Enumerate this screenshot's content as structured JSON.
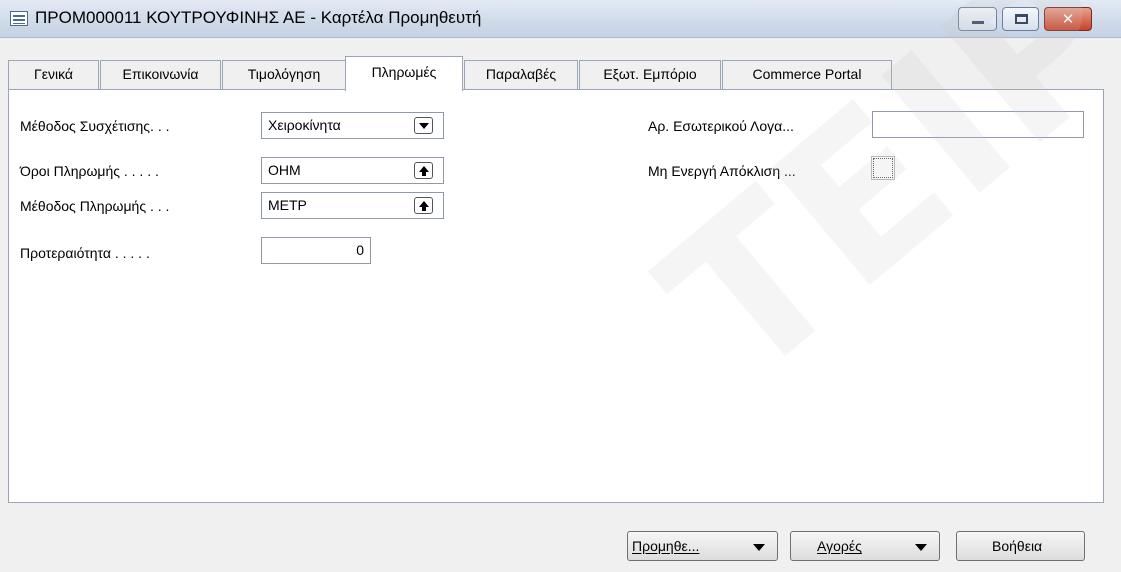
{
  "window": {
    "title": "ΠΡΟΜ000011 ΚΟΥΤΡΟΥΦΙΝΗΣ ΑΕ - Καρτέλα Προμηθευτή",
    "icon": "form-icon",
    "controls": {
      "minimize": "minimize-icon",
      "maximize": "maximize-icon",
      "close": "✕"
    }
  },
  "tabs": [
    {
      "label": "Γενικά"
    },
    {
      "label": "Επικοινωνία"
    },
    {
      "label": "Τιμολόγηση"
    },
    {
      "label": "Πληρωμές",
      "active": true
    },
    {
      "label": "Παραλαβές"
    },
    {
      "label": "Εξωτ. Εμπόριο"
    },
    {
      "label": "Commerce Portal"
    }
  ],
  "fields": {
    "matching_method": {
      "label": "Μέθοδος Συσχέτισης. . .",
      "value": "Χειροκίνητα"
    },
    "payment_terms": {
      "label": "Όροι Πληρωμής . . . . .",
      "value": "ΟΗΜ"
    },
    "payment_method": {
      "label": "Μέθοδος Πληρωμής . . .",
      "value": "ΜΕΤΡ"
    },
    "priority": {
      "label": "Προτεραιότητα . . . . .",
      "value": "0"
    },
    "internal_account_no": {
      "label": "Αρ. Εσωτερικού Λογα...",
      "value": ""
    },
    "inactive_block": {
      "label": "Μη Ενεργή Απόκλιση ...",
      "checked": false
    }
  },
  "buttons": {
    "vendor": "Προμηθε...",
    "purchases": "Αγορές",
    "help": "Βοήθεια"
  },
  "watermark": "ΤΕΙΡΑΙΑ",
  "colors": {
    "close_button": "#c8422a",
    "titlebar": "#cfdae9"
  }
}
